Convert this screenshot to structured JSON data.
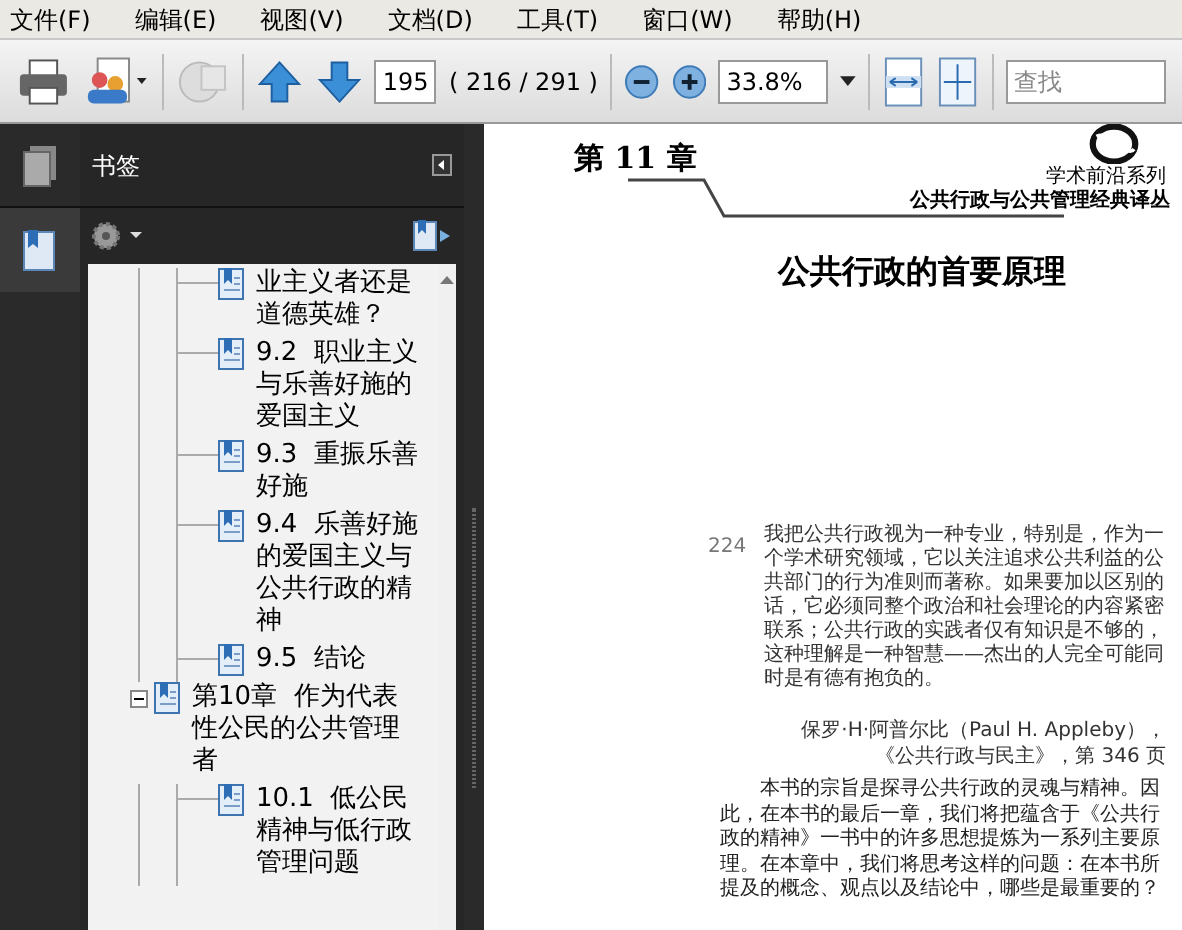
{
  "menu": [
    "文件(F)",
    "编辑(E)",
    "视图(V)",
    "文档(D)",
    "工具(T)",
    "窗口(W)",
    "帮助(H)"
  ],
  "toolbar": {
    "page_field": "195",
    "page_count": "( 216 / 291 )",
    "zoom": "33.8%",
    "search": {
      "placeholder": "查找"
    }
  },
  "bookmarks_panel": {
    "title": "书签",
    "items": [
      {
        "children": [
          {
            "label": "业主义者还是道德英雄？"
          },
          {
            "label": "9.2  职业主义与乐善好施的爱国主义"
          },
          {
            "label": "9.3  重振乐善好施"
          },
          {
            "label": "9.4  乐善好施的爱国主义与公共行政的精神"
          },
          {
            "label": "9.5  结论"
          }
        ]
      },
      {
        "label": "第10章  作为代表性公民的公共管理者",
        "expanded": true,
        "children": [
          {
            "label": "10.1  低公民精神与低行政管理问题"
          }
        ]
      }
    ]
  },
  "document": {
    "chapter": "第 11 章",
    "series": "学术前沿系列",
    "collection": "公共行政与公共管理经典译丛",
    "title": "公共行政的首要原理",
    "page_number": "224",
    "quote": "我把公共行政视为一种专业，特别是，作为一个学术研究领域，它以关注追求公共利益的公共部门的行为准则而著称。如果要加以区别的话，它必须同整个政治和社会理论的内容紧密联系；公共行政的实践者仅有知识是不够的，这种理解是一种智慧——杰出的人完全可能同时是有德有抱负的。",
    "attribution": [
      "保罗·H·阿普尔比（Paul H. Appleby），",
      "《公共行政与民主》，第 346 页"
    ],
    "paragraph": "本书的宗旨是探寻公共行政的灵魂与精神。因此，在本书的最后一章，我们将把蕴含于《公共行政的精神》一书中的许多思想提炼为一系列主要原理。在本章中，我们将思考这样的问题：在本书所提及的概念、观点以及结论中，哪些是最重要的？"
  }
}
